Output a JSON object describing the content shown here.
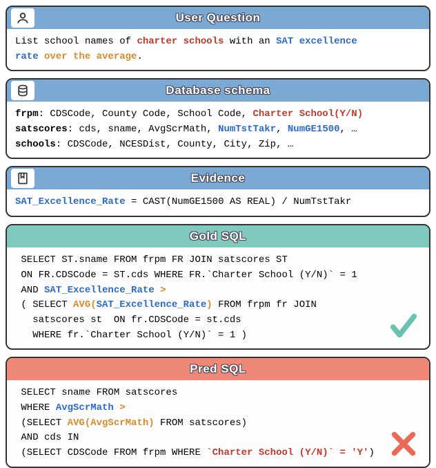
{
  "panels": {
    "question": {
      "title": "User Question",
      "icon": "user-icon",
      "lines": [
        [
          {
            "t": "List school names of ",
            "c": ""
          },
          {
            "t": "charter schools",
            "c": "red"
          },
          {
            "t": " with an ",
            "c": ""
          },
          {
            "t": "SAT excellence",
            "c": "blue"
          }
        ],
        [
          {
            "t": "rate",
            "c": "blue"
          },
          {
            "t": " ",
            "c": ""
          },
          {
            "t": "over the average",
            "c": "orange"
          },
          {
            "t": ".",
            "c": ""
          }
        ]
      ]
    },
    "schema": {
      "title": "Database schema",
      "icon": "database-icon",
      "rows": [
        {
          "table": "frpm",
          "cols_plain": "CDSCode, County Code, School Code, ",
          "cols_hl": "Charter School(Y/N)",
          "hl_class": "red",
          "suffix": ""
        },
        {
          "table": "satscores",
          "cols_plain": "cds, sname, AvgScrMath, ",
          "cols_hl": "NumTstTakr",
          "hl_class": "blue",
          "mid": ", ",
          "cols_hl2": "NumGE1500",
          "hl2_class": "blue",
          "suffix": ", …"
        },
        {
          "table": "schools",
          "cols_plain": "CDSCode, NCESDist, County, City, Zip, …",
          "cols_hl": "",
          "hl_class": "",
          "suffix": ""
        }
      ]
    },
    "evidence": {
      "title": "Evidence",
      "icon": "bookmark-icon",
      "line": [
        {
          "t": "SAT_Excellence_Rate",
          "c": "blue"
        },
        {
          "t": " = CAST(NumGE1500 AS REAL) / NumTstTakr",
          "c": ""
        }
      ]
    },
    "gold": {
      "title": "Gold SQL",
      "lines": [
        [
          {
            "t": " SELECT ST.sname FROM frpm FR JOIN satscores ST",
            "c": ""
          }
        ],
        [
          {
            "t": " ON FR.CDSCode = ST.cds WHERE FR.`Charter School (Y/N)` = 1",
            "c": ""
          }
        ],
        [
          {
            "t": " AND ",
            "c": ""
          },
          {
            "t": "SAT_Excellence_Rate",
            "c": "blue"
          },
          {
            "t": " ",
            "c": ""
          },
          {
            "t": ">",
            "c": "orange"
          }
        ],
        [
          {
            "t": " ( SELECT ",
            "c": ""
          },
          {
            "t": "AVG(",
            "c": "orange"
          },
          {
            "t": "SAT_Excellence_Rate",
            "c": "blue"
          },
          {
            "t": ")",
            "c": "orange"
          },
          {
            "t": " FROM frpm fr JOIN",
            "c": ""
          }
        ],
        [
          {
            "t": "   satscores st  ON fr.CDSCode = st.cds",
            "c": ""
          }
        ],
        [
          {
            "t": "   WHERE fr.`Charter School (Y/N)` = 1 )",
            "c": ""
          }
        ]
      ],
      "mark": "check"
    },
    "pred": {
      "title": "Pred SQL",
      "lines": [
        [
          {
            "t": " SELECT sname FROM satscores",
            "c": ""
          }
        ],
        [
          {
            "t": " WHERE ",
            "c": ""
          },
          {
            "t": "AvgScrMath",
            "c": "blue"
          },
          {
            "t": " ",
            "c": ""
          },
          {
            "t": ">",
            "c": "orange"
          }
        ],
        [
          {
            "t": " (SELECT ",
            "c": ""
          },
          {
            "t": "AVG(AvgScrMath)",
            "c": "orange"
          },
          {
            "t": " FROM satscores)",
            "c": ""
          }
        ],
        [
          {
            "t": " AND cds IN",
            "c": ""
          }
        ],
        [
          {
            "t": " (SELECT CDSCode FROM frpm WHERE ",
            "c": ""
          },
          {
            "t": "`Charter School (Y/N)` = 'Y'",
            "c": "red"
          },
          {
            "t": ")",
            "c": ""
          }
        ]
      ],
      "mark": "cross"
    }
  }
}
